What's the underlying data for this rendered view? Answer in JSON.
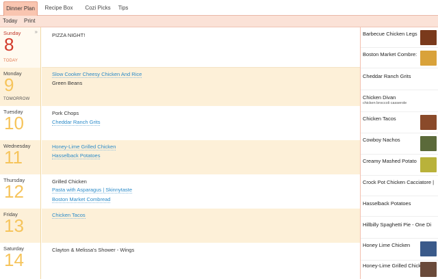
{
  "tabs": [
    {
      "label": "Dinner Plan",
      "active": true
    },
    {
      "label": "Recipe Box",
      "active": false
    },
    {
      "label": "Cozi Picks",
      "active": false
    },
    {
      "label": "Tips",
      "active": false
    }
  ],
  "toolbar": {
    "today_label": "Today",
    "print_label": "Print"
  },
  "collapse_glyph": "»",
  "days": [
    {
      "name": "Sunday",
      "number": "8",
      "tag": "TODAY",
      "meals": [
        {
          "text": "PIZZA NIGHT!",
          "link": false
        }
      ]
    },
    {
      "name": "Monday",
      "number": "9",
      "tag": "TOMORROW",
      "meals": [
        {
          "text": "Slow Cooker Cheesy Chicken And Rice",
          "link": true
        },
        {
          "text": "Green Beans",
          "link": false
        }
      ]
    },
    {
      "name": "Tuesday",
      "number": "10",
      "tag": "",
      "meals": [
        {
          "text": "Pork Chops",
          "link": false
        },
        {
          "text": "Cheddar Ranch Grits",
          "link": true
        }
      ]
    },
    {
      "name": "Wednesday",
      "number": "11",
      "tag": "",
      "meals": [
        {
          "text": "Honey-Lime Grilled Chicken",
          "link": true
        },
        {
          "text": "Hasselback Potatoes",
          "link": true
        }
      ]
    },
    {
      "name": "Thursday",
      "number": "12",
      "tag": "",
      "meals": [
        {
          "text": "Grilled Chicken",
          "link": false
        },
        {
          "text": "Pasta with Asparagus | Skinnytaste",
          "link": true
        },
        {
          "text": "Boston Market Combread",
          "link": true
        }
      ]
    },
    {
      "name": "Friday",
      "number": "13",
      "tag": "",
      "meals": [
        {
          "text": "Chicken Tacos",
          "link": true
        }
      ]
    },
    {
      "name": "Saturday",
      "number": "14",
      "tag": "",
      "meals": [
        {
          "text": "Clayton & Melissa's Shower - Wings",
          "link": false
        }
      ]
    }
  ],
  "recipes": [
    {
      "name": "Barbecue Chicken Legs",
      "sub": "",
      "thumb": "#7a3a1c"
    },
    {
      "name": "Boston Market Combre:",
      "sub": "",
      "thumb": "#d9a23a"
    },
    {
      "name": "Cheddar Ranch Grits",
      "sub": "",
      "thumb": ""
    },
    {
      "name": "Chicken Divan",
      "sub": "chicken broccoli casserole",
      "thumb": ""
    },
    {
      "name": "Chicken Tacos",
      "sub": "",
      "thumb": "#8a4a2a"
    },
    {
      "name": "Cowboy Nachos",
      "sub": "",
      "thumb": "#5b6a3a"
    },
    {
      "name": "Creamy Mashed Potato",
      "sub": "",
      "thumb": "#b9b23a"
    },
    {
      "name": "Crock Pot Chicken Cacciatore |",
      "sub": "",
      "thumb": ""
    },
    {
      "name": "Hasselback Potatoes",
      "sub": "",
      "thumb": ""
    },
    {
      "name": "Hillbilly Spaghetti Pie - One Di",
      "sub": "",
      "thumb": ""
    },
    {
      "name": "Honey Lime Chicken",
      "sub": "",
      "thumb": "#3a5a8a"
    },
    {
      "name": "Honey-Lime Grilled Chicken",
      "sub": "",
      "thumb": "#6a4a3a"
    }
  ]
}
